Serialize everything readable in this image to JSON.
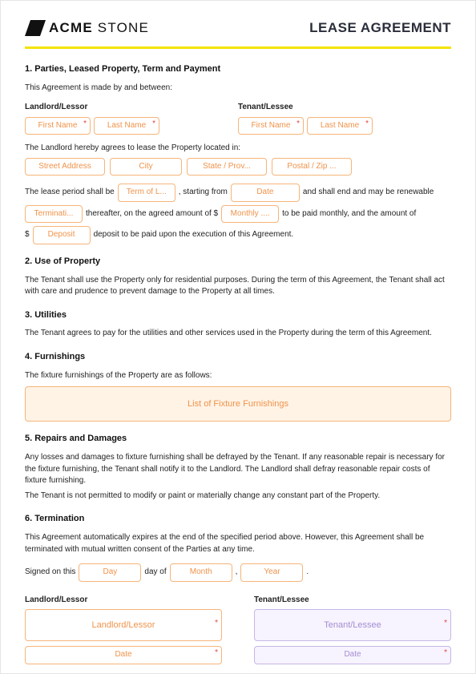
{
  "brand": {
    "name_strong": "ACME",
    "name_light": " STONE"
  },
  "doc_title": "LEASE AGREEMENT",
  "s1": {
    "heading": "1. Parties, Leased Property, Term and Payment",
    "intro": "This Agreement is made by and between:",
    "landlord_label": "Landlord/Lessor",
    "tenant_label": "Tenant/Lessee",
    "first_name_ph": "First Name",
    "last_name_ph": "Last Name",
    "lease_located": "The Landlord hereby agrees to lease the Property located in:",
    "street_ph": "Street Address",
    "city_ph": "City",
    "state_ph": "State / Prov...",
    "postal_ph": "Postal / Zip ...",
    "p2a": "The lease period shall be",
    "term_ph": "Term of L...",
    "p2b": ", starting from",
    "date_ph": "Date",
    "p2c": "and shall end and may be renewable",
    "termination_ph": "Terminati...",
    "p2d": "thereafter, on the agreed amount of $",
    "monthly_ph": "Monthly ....",
    "p2e": "to be paid monthly, and the amount of",
    "p2f": "$",
    "deposit_ph": "Deposit",
    "p2g": "deposit to be paid upon the execution of this Agreement."
  },
  "s2": {
    "heading": "2. Use of Property",
    "body": "The Tenant shall use the Property only for residential purposes. During the term of this Agreement, the Tenant shall act with care and prudence to prevent damage to the Property at all times."
  },
  "s3": {
    "heading": "3. Utilities",
    "body": "The Tenant agrees to pay for the utilities and other services used in the Property during the term of this Agreement."
  },
  "s4": {
    "heading": "4. Furnishings",
    "body": "The fixture furnishings of the Property are as follows:",
    "furn_ph": "List of Fixture Furnishings"
  },
  "s5": {
    "heading": "5. Repairs and Damages",
    "body1": "Any losses and damages to fixture furnishing shall be defrayed by the Tenant. If any reasonable repair is necessary for the fixture furnishing, the Tenant shall notify it to the Landlord. The Landlord shall defray reasonable repair costs of fixture furnishing.",
    "body2": "The Tenant is not permitted to modify or paint or materially change any constant part of the Property."
  },
  "s6": {
    "heading": "6. Termination",
    "body": "This Agreement automatically expires at the end of the specified period above. However, this Agreement shall be terminated with mutual written consent of the Parties at any time."
  },
  "sign": {
    "signed_on": "Signed on this",
    "day_ph": "Day",
    "day_of": "day of",
    "month_ph": "Month",
    "comma": ",",
    "year_ph": "Year",
    "period": ".",
    "landlord_label": "Landlord/Lessor",
    "tenant_label": "Tenant/Lessee",
    "landlord_sig_ph": "Landlord/Lessor",
    "tenant_sig_ph": "Tenant/Lessee",
    "date_ph": "Date"
  }
}
